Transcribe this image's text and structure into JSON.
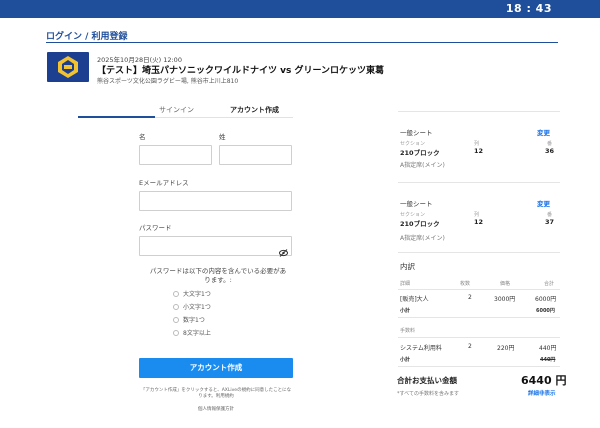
{
  "status_bar": {
    "time": "18 : 43"
  },
  "page": {
    "title": "ログイン / 利用登録"
  },
  "event": {
    "date": "2025年10月28日(火) 12:00",
    "name": "【テスト】埼玉パナソニックワイルドナイツ vs グリーンロケッツ東葛",
    "venue": "熊谷スポーツ文化公園ラグビー場, 熊谷市上川上810"
  },
  "tabs": {
    "signin": "サインイン",
    "create": "アカウント作成"
  },
  "form": {
    "first_name_label": "名",
    "last_name_label": "姓",
    "email_label": "Eメールアドレス",
    "password_label": "パスワード",
    "password_rules_title": "パスワードは以下の内容を含んでいる必要があります。:",
    "rules": [
      "大文字1つ",
      "小文字1つ",
      "数字1つ",
      "8文字以上"
    ],
    "submit_label": "アカウント作成",
    "terms_text": "「アカウント作成」をクリックすると、AXLiveの規約に同意したことになります。利用規約",
    "privacy_text": "個人情報保護方針"
  },
  "seats": [
    {
      "type": "一般シート",
      "change": "変更",
      "section_label": "セクション",
      "section": "210ブロック",
      "row_label": "列",
      "row": "12",
      "seat_label": "番",
      "seat": "36",
      "gate": "A指定席(メイン)"
    },
    {
      "type": "一般シート",
      "change": "変更",
      "section_label": "セクション",
      "section": "210ブロック",
      "row_label": "列",
      "row": "12",
      "seat_label": "番",
      "seat": "37",
      "gate": "A指定席(メイン)"
    }
  ],
  "breakdown": {
    "title": "内訳",
    "headers": {
      "detail": "詳細",
      "qty": "枚数",
      "price": "価格",
      "total": "合計"
    },
    "ticket_row": {
      "name": "[販売]大人",
      "qty": "2",
      "price": "3000円",
      "total": "6000円"
    },
    "subtotal_label": "小計",
    "subtotal": "6000円",
    "fees_label": "手数料",
    "fee_row": {
      "name": "システム利用料",
      "qty": "2",
      "price": "220円",
      "total": "440円"
    },
    "fee_subtotal_label": "小計",
    "fee_subtotal": "440円"
  },
  "total": {
    "label": "合計お支払い金額",
    "value": "6440 円",
    "note": "*すべての手数料を含みます",
    "detail_link": "詳細非表示"
  },
  "colors": {
    "brand": "#1f4e9a",
    "button": "#1a8cf0",
    "link": "#1a73e8"
  }
}
